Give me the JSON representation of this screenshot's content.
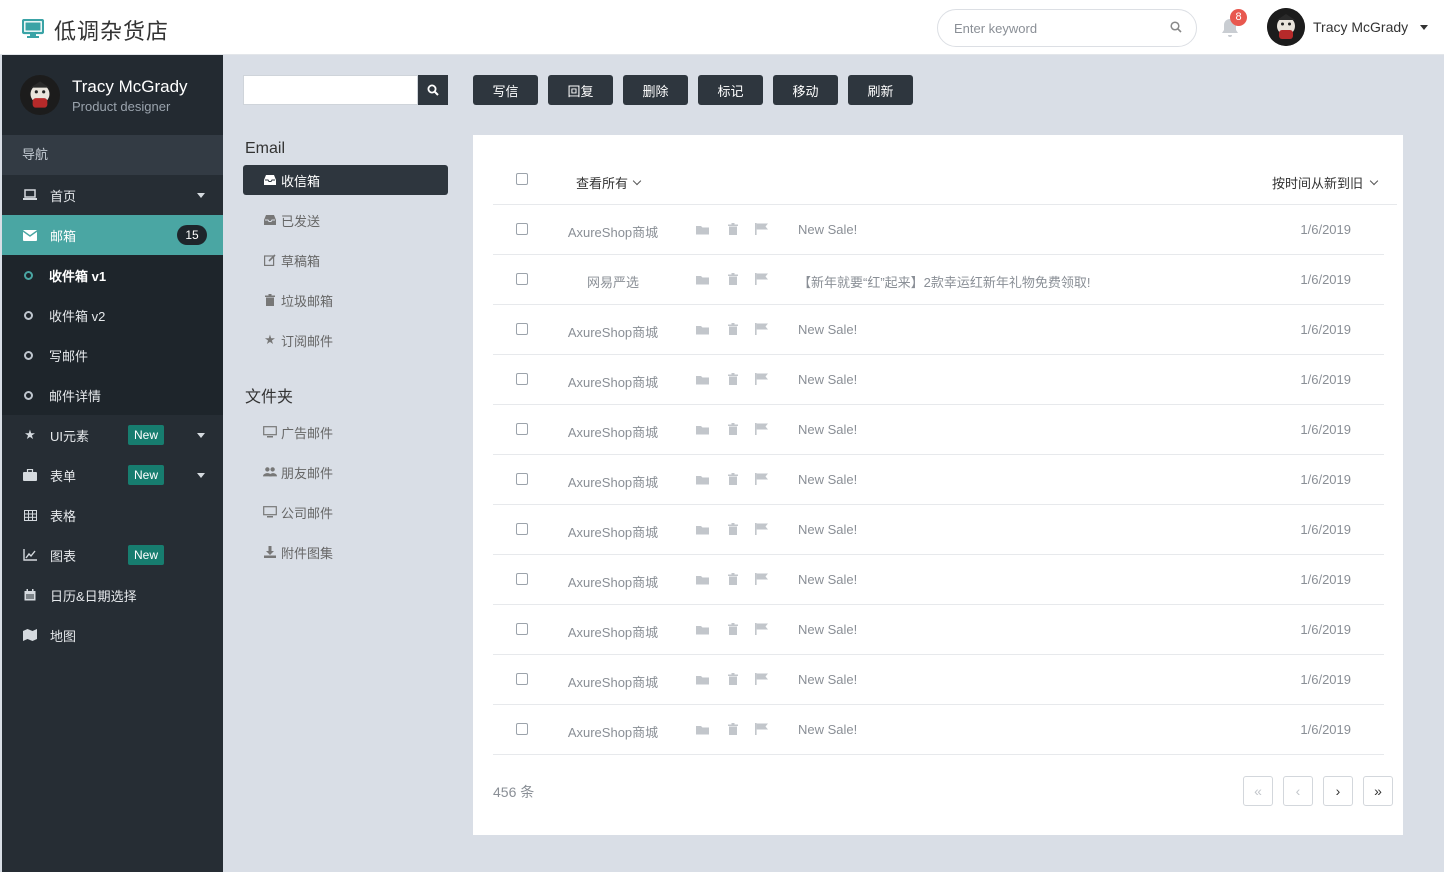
{
  "header": {
    "app_title": "低调杂货店",
    "search_placeholder": "Enter keyword",
    "notification_count": "8",
    "user_name": "Tracy McGrady"
  },
  "sidebar": {
    "profile_name": "Tracy McGrady",
    "profile_role": "Product designer",
    "section_label": "导航",
    "items": [
      {
        "label": "首页",
        "icon": "laptop-icon"
      },
      {
        "label": "邮箱",
        "icon": "envelope-icon",
        "count": "15"
      },
      {
        "label": "UI元素",
        "icon": "star-icon",
        "badge": "New"
      },
      {
        "label": "表单",
        "icon": "briefcase-icon",
        "badge": "New"
      },
      {
        "label": "表格",
        "icon": "table-icon"
      },
      {
        "label": "图表",
        "icon": "line-chart-icon",
        "badge": "New"
      },
      {
        "label": "日历&日期选择",
        "icon": "calendar-icon"
      },
      {
        "label": "地图",
        "icon": "map-icon"
      }
    ],
    "mail_subitems": [
      "收件箱 v1",
      "收件箱 v2",
      "写邮件",
      "邮件详情"
    ]
  },
  "mail_nav": {
    "email_title": "Email",
    "email_folders": [
      {
        "label": "收信箱",
        "icon": "inbox-icon"
      },
      {
        "label": "已发送",
        "icon": "inbox-icon"
      },
      {
        "label": "草稿箱",
        "icon": "edit-icon"
      },
      {
        "label": "垃圾邮箱",
        "icon": "trash-icon"
      },
      {
        "label": "订阅邮件",
        "icon": "star-icon"
      }
    ],
    "folders_title": "文件夹",
    "custom_folders": [
      {
        "label": "广告邮件",
        "icon": "desktop-icon"
      },
      {
        "label": "朋友邮件",
        "icon": "users-icon"
      },
      {
        "label": "公司邮件",
        "icon": "desktop-icon"
      },
      {
        "label": "附件图集",
        "icon": "download-icon"
      }
    ]
  },
  "toolbar": [
    "写信",
    "回复",
    "删除",
    "标记",
    "移动",
    "刷新"
  ],
  "list": {
    "view_all": "查看所有",
    "sort_label": "按时间从新到旧",
    "rows": [
      {
        "sender": "AxureShop商城",
        "subject": "New Sale!",
        "date": "1/6/2019"
      },
      {
        "sender": "网易严选",
        "subject": "【新年就要“红”起来】2款幸运红新年礼物免费领取!",
        "date": "1/6/2019"
      },
      {
        "sender": "AxureShop商城",
        "subject": "New Sale!",
        "date": "1/6/2019"
      },
      {
        "sender": "AxureShop商城",
        "subject": "New Sale!",
        "date": "1/6/2019"
      },
      {
        "sender": "AxureShop商城",
        "subject": "New Sale!",
        "date": "1/6/2019"
      },
      {
        "sender": "AxureShop商城",
        "subject": "New Sale!",
        "date": "1/6/2019"
      },
      {
        "sender": "AxureShop商城",
        "subject": "New Sale!",
        "date": "1/6/2019"
      },
      {
        "sender": "AxureShop商城",
        "subject": "New Sale!",
        "date": "1/6/2019"
      },
      {
        "sender": "AxureShop商城",
        "subject": "New Sale!",
        "date": "1/6/2019"
      },
      {
        "sender": "AxureShop商城",
        "subject": "New Sale!",
        "date": "1/6/2019"
      },
      {
        "sender": "AxureShop商城",
        "subject": "New Sale!",
        "date": "1/6/2019"
      }
    ],
    "total": "456 条",
    "pager": [
      "«",
      "‹",
      "›",
      "»"
    ]
  },
  "colors": {
    "accent": "#4aa6a3",
    "sidebar_bg": "#262d34",
    "badge_green": "#177d6f",
    "notify_red": "#e8584f",
    "button_dark": "#2e363e"
  }
}
